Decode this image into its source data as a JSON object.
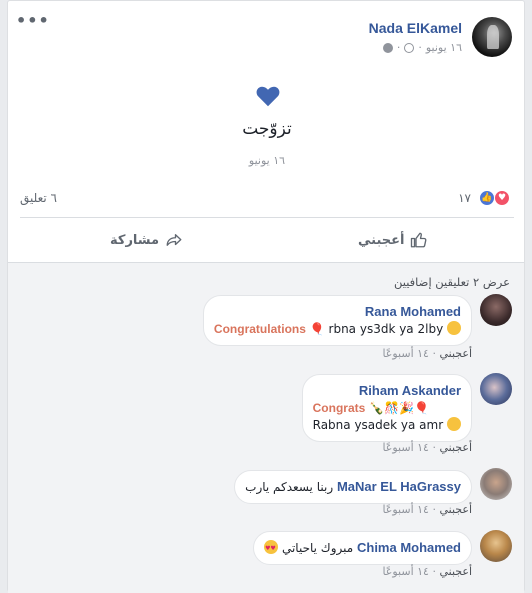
{
  "post": {
    "author": "Nada ElKamel",
    "date": "١٦ يونيو",
    "more": "•••",
    "event_title": "تزوّجت",
    "event_date": "١٦ يونيو",
    "reaction_count": "١٧",
    "comment_count": "٦ تعليق",
    "like_label": "أعجبني",
    "share_label": "مشاركة"
  },
  "comments_section": {
    "view_more": "عرض ٢ تعليقين إضافيين",
    "items": [
      {
        "name": "Rana Mohamed",
        "text": "rbna ys3dk ya 2lby",
        "highlight": "Congratulations",
        "like": "أعجبني",
        "time": "١٤ أسبوعًا"
      },
      {
        "name": "Riham Askander",
        "highlight": "Congrats",
        "text": "Rabna ysadek ya amr",
        "like": "أعجبني",
        "time": "١٤ أسبوعًا"
      },
      {
        "name": "MaNar EL HaGrassy",
        "text": "ربنا يسعدكم يارب",
        "like": "أعجبني",
        "time": "١٤ أسبوعًا"
      },
      {
        "name": "Chima Mohamed",
        "text": "مبروك ياحياتي",
        "like": "أعجبني",
        "time": "١٤ أسبوعًا"
      }
    ]
  },
  "colors": {
    "link": "#365899",
    "heart": "#4267b2",
    "highlight": "#d9745c"
  }
}
